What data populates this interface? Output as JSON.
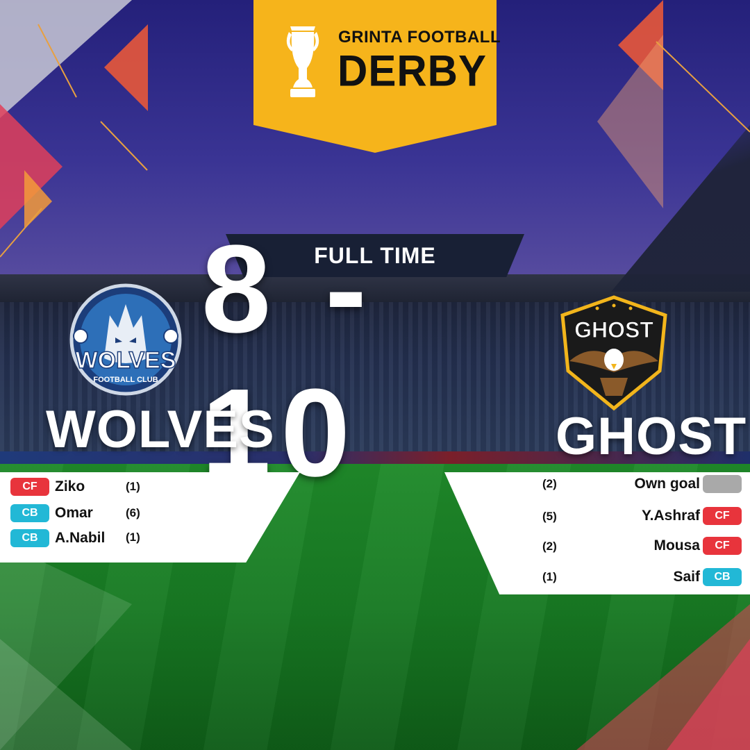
{
  "header": {
    "line1": "GRINTA FOOTBALL",
    "line2": "DERBY",
    "trophy_icon": "trophy-icon"
  },
  "status": "FULL TIME",
  "score": {
    "home": "8",
    "separator": "-",
    "away": "10",
    "display": "8 - 10"
  },
  "home": {
    "name": "WOLVES",
    "logo_text": "WOLVES",
    "logo_subtext": "FOOTBALL CLUB",
    "scorers": [
      {
        "position": "CF",
        "name": "Ziko",
        "goals": "(1)"
      },
      {
        "position": "CB",
        "name": "Omar",
        "goals": "(6)"
      },
      {
        "position": "CB",
        "name": "A.Nabil",
        "goals": "(1)"
      }
    ]
  },
  "away": {
    "name": "GHOST",
    "logo_text": "GHOST",
    "scorers": [
      {
        "position": "",
        "name": "Own goal",
        "goals": "(2)"
      },
      {
        "position": "CF",
        "name": "Y.Ashraf",
        "goals": "(5)"
      },
      {
        "position": "CF",
        "name": "Mousa",
        "goals": "(2)"
      },
      {
        "position": "CB",
        "name": "Saif",
        "goals": "(1)"
      }
    ]
  },
  "colors": {
    "accent_yellow": "#f6b41b",
    "cf_red": "#e8343c",
    "cb_cyan": "#22b8d6",
    "banner_navy": "#182035",
    "own_goal_gray": "#a9a9a9"
  }
}
